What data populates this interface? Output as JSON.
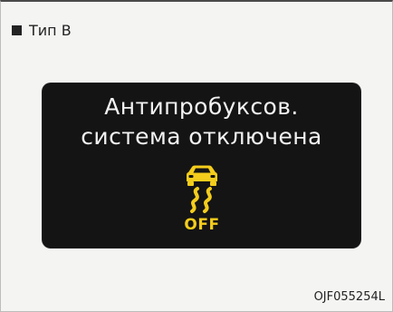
{
  "header": {
    "type_label": "Тип B"
  },
  "display": {
    "line1": "Антипробуксов.",
    "line2": "система отключена",
    "indicator_icon": "traction-control-off-icon",
    "indicator_text": "OFF",
    "indicator_color": "#f4cd1c",
    "screen_color": "#141414",
    "text_color": "#f2f2f2"
  },
  "footer": {
    "image_code": "OJF055254L"
  }
}
